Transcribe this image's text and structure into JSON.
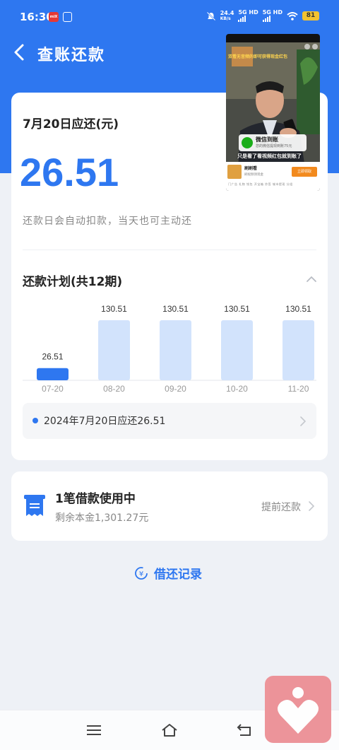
{
  "colors": {
    "accent": "#2e77f0",
    "bar_current": "#2e77f0",
    "bar_future": "#d2e3fc",
    "background": "#eef1f6"
  },
  "status_bar": {
    "time": "16:30",
    "app_badge": "miX",
    "net_speed_value": "24.4",
    "net_speed_unit": "KB/s",
    "sim1": "5G HD",
    "sim2": "5G HD",
    "battery": "81",
    "icons": [
      "mute-icon",
      "signal-icon",
      "wifi-icon",
      "battery-icon"
    ]
  },
  "nav": {
    "title": "查账还款",
    "back_icon": "chevron-left-icon"
  },
  "summary": {
    "due_label": "7月20日应还(元)",
    "due_amount": "26.51",
    "auto_note": "还款日会自动扣款，当天也可主动还"
  },
  "plan": {
    "title": "还款计划(共12期)",
    "collapse_icon": "chevron-up-icon",
    "next_due_text": "2024年7月20日应还26.51"
  },
  "chart_data": {
    "type": "bar",
    "categories": [
      "07-20",
      "08-20",
      "09-20",
      "10-20",
      "11-20"
    ],
    "values": [
      26.51,
      130.51,
      130.51,
      130.51,
      130.51
    ],
    "value_labels": [
      "26.51",
      "130.51",
      "130.51",
      "130.51",
      "130.51"
    ],
    "title": "",
    "xlabel": "",
    "ylabel": "",
    "ylim": [
      0,
      130.51
    ],
    "highlighted_index": 0,
    "grid": false,
    "legend": "none"
  },
  "loan": {
    "icon": "receipt-icon",
    "title": "1笔借款使用中",
    "remaining": "剩余本金1,301.27元",
    "prepay_label": "提前还款"
  },
  "history": {
    "label": "借还记录",
    "icon": "loan-history-icon"
  },
  "bottom_nav": {
    "icons": [
      "menu-icon",
      "home-icon",
      "back-icon"
    ]
  },
  "pip_video": {
    "caption": "双看无音频的即可获得现金红包",
    "wechat_title": "微信到账",
    "wechat_sub": "您的微信提现到账75元",
    "subtitle": "只是看了看视频红包就到账了",
    "ad_name": "刷刷看",
    "ad_desc": "刷视频领现金",
    "ad_button": "立即领取",
    "ad_tabs": "门广告  礼物  钱包  开宝箱  抄签  城市提现  分组"
  }
}
